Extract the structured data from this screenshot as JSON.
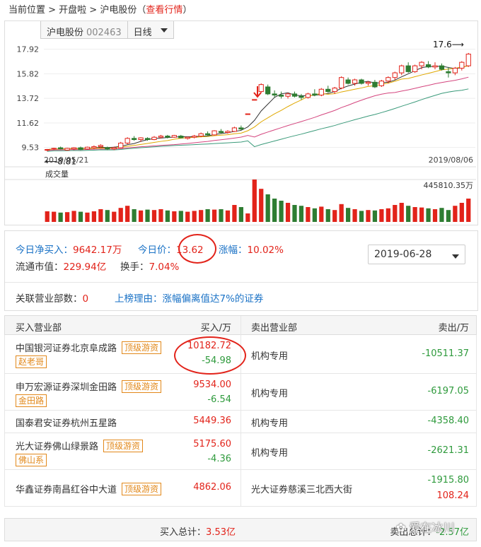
{
  "breadcrumb": {
    "prefix": "当前位置 > 开盘啦 > 沪电股份（",
    "link": "查看行情",
    "suffix": "）"
  },
  "chart_toolbar": {
    "stock_name": "沪电股份",
    "stock_code": "002463",
    "period": "日线"
  },
  "chart_data": [
    {
      "type": "candlestick",
      "y_ticks": [
        "17.92",
        "15.82",
        "13.72",
        "11.62",
        "9.53"
      ],
      "ylim": [
        8.6,
        18.5
      ],
      "x_labels": [
        "2019/05/21",
        "2019/08/06"
      ],
      "annotations": {
        "high": "17.6",
        "low": "8.81"
      },
      "up_color": "#e2231a",
      "down_color": "#2e7d32",
      "candles": [
        [
          9.3,
          9.4,
          9.2,
          9.35
        ],
        [
          9.4,
          9.5,
          9.3,
          9.45
        ],
        [
          9.5,
          9.6,
          9.35,
          9.4
        ],
        [
          9.3,
          9.5,
          9.25,
          9.45
        ],
        [
          9.4,
          9.55,
          9.3,
          9.5
        ],
        [
          9.5,
          9.6,
          9.3,
          9.35
        ],
        [
          9.4,
          9.6,
          9.35,
          9.55
        ],
        [
          9.5,
          9.7,
          9.4,
          9.6
        ],
        [
          9.6,
          9.8,
          9.5,
          9.7
        ],
        [
          9.5,
          9.6,
          9.3,
          9.4
        ],
        [
          9.4,
          9.6,
          9.3,
          9.5
        ],
        [
          9.5,
          10.0,
          9.45,
          9.9
        ],
        [
          9.9,
          10.4,
          9.8,
          10.3
        ],
        [
          10.3,
          10.5,
          10.1,
          10.2
        ],
        [
          10.2,
          10.4,
          10.0,
          10.35
        ],
        [
          10.3,
          10.4,
          10.1,
          10.2
        ],
        [
          10.2,
          10.5,
          10.15,
          10.4
        ],
        [
          10.4,
          10.6,
          10.3,
          10.5
        ],
        [
          10.5,
          10.6,
          10.3,
          10.4
        ],
        [
          10.4,
          10.6,
          10.35,
          10.55
        ],
        [
          10.5,
          10.6,
          10.3,
          10.35
        ],
        [
          10.3,
          10.45,
          10.2,
          10.4
        ],
        [
          10.4,
          10.6,
          10.3,
          10.5
        ],
        [
          10.5,
          10.8,
          10.4,
          10.7
        ],
        [
          10.7,
          10.9,
          10.5,
          10.6
        ],
        [
          10.6,
          11.0,
          10.55,
          10.95
        ],
        [
          10.9,
          11.1,
          10.7,
          10.8
        ],
        [
          10.8,
          11.0,
          10.7,
          10.9
        ],
        [
          10.9,
          11.3,
          10.85,
          11.2
        ],
        [
          11.2,
          11.4,
          11.0,
          11.1
        ],
        [
          12.4,
          12.4,
          12.4,
          12.4
        ],
        [
          13.62,
          13.62,
          13.62,
          13.62
        ],
        [
          14.3,
          15.0,
          14.2,
          14.9
        ],
        [
          14.7,
          14.9,
          14.0,
          14.1
        ],
        [
          14.1,
          14.4,
          13.8,
          14.0
        ],
        [
          14.0,
          14.3,
          13.7,
          13.9
        ],
        [
          13.9,
          14.2,
          13.7,
          14.1
        ],
        [
          14.1,
          14.3,
          13.8,
          13.9
        ],
        [
          13.9,
          14.1,
          13.6,
          13.8
        ],
        [
          13.8,
          14.2,
          13.7,
          14.1
        ],
        [
          14.1,
          14.5,
          13.9,
          14.0
        ],
        [
          14.0,
          14.6,
          13.9,
          14.5
        ],
        [
          14.5,
          14.8,
          14.2,
          14.3
        ],
        [
          14.3,
          14.7,
          14.1,
          14.6
        ],
        [
          14.6,
          15.6,
          14.5,
          15.5
        ],
        [
          15.3,
          15.5,
          14.9,
          15.0
        ],
        [
          15.0,
          15.4,
          14.8,
          15.3
        ],
        [
          15.3,
          15.4,
          14.9,
          15.0
        ],
        [
          15.0,
          15.2,
          14.8,
          15.1
        ],
        [
          15.1,
          15.3,
          14.6,
          14.7
        ],
        [
          14.8,
          15.3,
          14.7,
          15.2
        ],
        [
          15.2,
          15.6,
          15.0,
          15.5
        ],
        [
          15.5,
          16.0,
          15.3,
          15.9
        ],
        [
          15.9,
          16.6,
          15.7,
          16.5
        ],
        [
          16.5,
          16.8,
          15.9,
          16.0
        ],
        [
          16.0,
          16.6,
          15.9,
          16.5
        ],
        [
          16.5,
          16.9,
          16.2,
          16.8
        ],
        [
          16.6,
          16.9,
          16.3,
          16.4
        ],
        [
          16.4,
          16.8,
          16.2,
          16.5
        ],
        [
          16.5,
          16.7,
          16.1,
          16.2
        ],
        [
          16.0,
          16.4,
          15.5,
          15.9
        ],
        [
          15.9,
          16.4,
          15.7,
          16.3
        ],
        [
          16.3,
          16.9,
          16.1,
          16.8
        ],
        [
          16.5,
          17.6,
          16.4,
          17.5
        ]
      ],
      "volume": {
        "label": "成交量",
        "max_label": "445810.35万",
        "values": [
          0.25,
          0.24,
          0.22,
          0.23,
          0.26,
          0.24,
          0.22,
          0.25,
          0.3,
          0.28,
          0.24,
          0.33,
          0.38,
          0.3,
          0.27,
          0.29,
          0.28,
          0.3,
          0.27,
          0.25,
          0.26,
          0.24,
          0.26,
          0.28,
          0.3,
          0.29,
          0.3,
          0.27,
          0.4,
          0.35,
          0.2,
          1.0,
          0.78,
          0.65,
          0.55,
          0.5,
          0.45,
          0.4,
          0.38,
          0.35,
          0.32,
          0.36,
          0.3,
          0.28,
          0.42,
          0.33,
          0.3,
          0.26,
          0.28,
          0.27,
          0.3,
          0.32,
          0.4,
          0.45,
          0.38,
          0.35,
          0.34,
          0.32,
          0.3,
          0.33,
          0.28,
          0.38,
          0.45,
          0.55
        ]
      }
    }
  ],
  "info": {
    "net_buy_label": "今日净买入：",
    "net_buy_value": "9642.17万",
    "price_label": "今日价：",
    "price_value": "13.62",
    "change_label": "涨幅：",
    "change_value": "10.02%",
    "mkt_cap_label": "流通市值：",
    "mkt_cap_value": "229.94亿",
    "turnover_label": "换手：",
    "turnover_value": "7.04%",
    "date": "2019-06-28",
    "dept_count_label": "关联营业部数：",
    "dept_count_value": "0",
    "reason": "上榜理由：涨幅偏离值达7%的证券"
  },
  "table": {
    "headers": {
      "buy_dept": "买入营业部",
      "buy_amt": "买入/万",
      "sell_dept": "卖出营业部",
      "sell_amt": "卖出/万"
    },
    "rows": [
      {
        "buy": "中国银河证券北京阜成路",
        "tag": "顶级游资",
        "tag2": "赵老哥",
        "buy_amt": "10182.72",
        "buy_amt2": "-54.98",
        "sell": "机构专用",
        "sell_amt": "-10511.37",
        "sell_amt2": ""
      },
      {
        "buy": "申万宏源证券深圳金田路",
        "tag": "顶级游资",
        "tag2": "金田路",
        "buy_amt": "9534.00",
        "buy_amt2": "-6.54",
        "sell": "机构专用",
        "sell_amt": "-6197.05",
        "sell_amt2": ""
      },
      {
        "buy": "国泰君安证券杭州五星路",
        "tag": "",
        "tag2": "",
        "buy_amt": "5449.36",
        "buy_amt2": "",
        "sell": "机构专用",
        "sell_amt": "-4358.40",
        "sell_amt2": ""
      },
      {
        "buy": "光大证券佛山绿景路",
        "tag": "顶级游资",
        "tag2": "佛山系",
        "buy_amt": "5175.60",
        "buy_amt2": "-4.36",
        "sell": "机构专用",
        "sell_amt": "-2621.31",
        "sell_amt2": ""
      },
      {
        "buy": "华鑫证券南昌红谷中大道",
        "tag": "顶级游资",
        "tag2": "",
        "buy_amt": "4862.06",
        "buy_amt2": "",
        "sell": "光大证券慈溪三北西大街",
        "sell_amt": "-1915.80",
        "sell_amt2": "108.24"
      }
    ],
    "footer_buy_label": "买入总计：",
    "footer_buy_value": "3.53亿",
    "footer_sell_label": "卖出总计：",
    "footer_sell_value": "-2.57亿"
  },
  "watermark": "爱在冰川"
}
